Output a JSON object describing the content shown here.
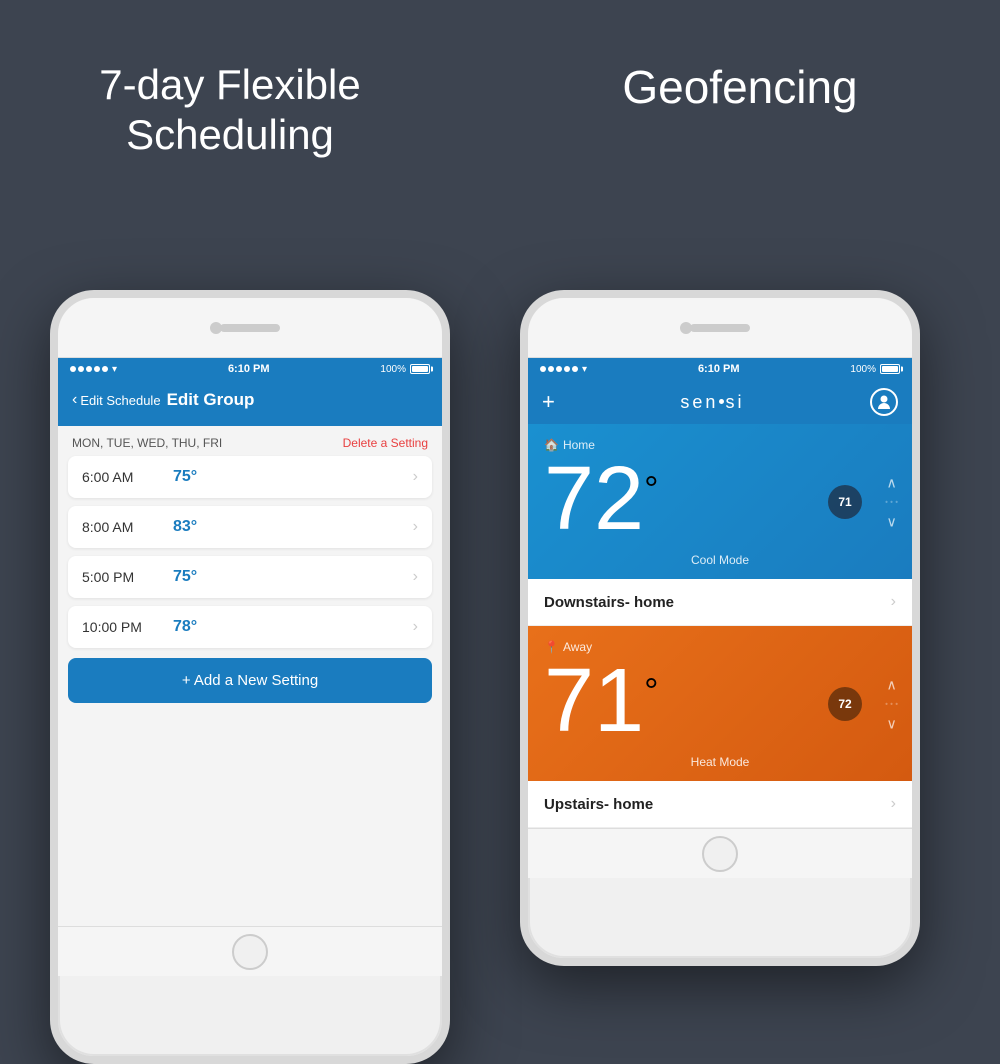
{
  "background_color": "#3d4450",
  "left_title": "7-day Flexible Scheduling",
  "right_title": "Geofencing",
  "left_phone": {
    "status_bar": {
      "time": "6:10 PM",
      "battery": "100%"
    },
    "header": {
      "back_label": "Edit Schedule",
      "title": "Edit Group"
    },
    "days": "MON, TUE, WED, THU, FRI",
    "delete_label": "Delete a Setting",
    "schedule_items": [
      {
        "time": "6:00 AM",
        "temp": "75°"
      },
      {
        "time": "8:00 AM",
        "temp": "83°"
      },
      {
        "time": "5:00 PM",
        "temp": "75°"
      },
      {
        "time": "10:00 PM",
        "temp": "78°"
      }
    ],
    "add_button": "+ Add a New Setting"
  },
  "right_phone": {
    "status_bar": {
      "time": "6:10 PM",
      "battery": "100%"
    },
    "logo": "sen·si",
    "cards": [
      {
        "mode_label": "Home",
        "big_temp": "72",
        "degree": "°",
        "set_temp": "71",
        "mode_text": "Cool Mode",
        "thermostat_name": "Downstairs- home",
        "type": "cool"
      },
      {
        "mode_label": "Away",
        "big_temp": "71",
        "degree": "°",
        "set_temp": "72",
        "mode_text": "Heat Mode",
        "thermostat_name": "Upstairs- home",
        "type": "heat"
      }
    ]
  }
}
